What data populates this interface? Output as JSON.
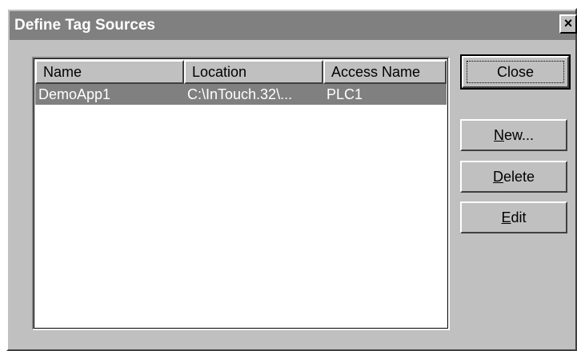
{
  "window": {
    "title": "Define Tag Sources",
    "close_glyph": "×"
  },
  "list": {
    "columns": [
      "Name",
      "Location",
      "Access Name"
    ],
    "rows": [
      {
        "name": "DemoApp1",
        "location": "C:\\InTouch.32\\...",
        "access_name": "PLC1",
        "selected": true
      }
    ]
  },
  "buttons": {
    "close": {
      "label": "Close"
    },
    "new": {
      "accel": "N",
      "rest": "ew..."
    },
    "delete": {
      "accel": "D",
      "rest": "elete"
    },
    "edit": {
      "accel": "E",
      "rest": "dit"
    }
  },
  "colors": {
    "face": "#c0c0c0",
    "titlebar_inactive": "#808080",
    "selection": "#808080"
  }
}
